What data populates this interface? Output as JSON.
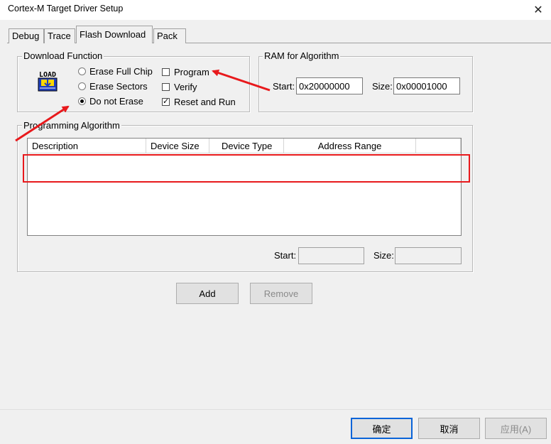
{
  "window": {
    "title": "Cortex-M Target Driver Setup",
    "close_glyph": "✕"
  },
  "tabs": [
    {
      "label": "Debug"
    },
    {
      "label": "Trace"
    },
    {
      "label": "Flash Download"
    },
    {
      "label": "Pack"
    }
  ],
  "download_function": {
    "title": "Download Function",
    "icon_text": "LOAD",
    "radios": [
      {
        "label": "Erase Full Chip",
        "selected": false
      },
      {
        "label": "Erase Sectors",
        "selected": false
      },
      {
        "label": "Do not Erase",
        "selected": true
      }
    ],
    "checkboxes": [
      {
        "label": "Program",
        "checked": false
      },
      {
        "label": "Verify",
        "checked": false
      },
      {
        "label": "Reset and Run",
        "checked": true,
        "mark": "✓"
      }
    ]
  },
  "ram": {
    "title": "RAM for Algorithm",
    "start_label": "Start:",
    "start_value": "0x20000000",
    "size_label": "Size:",
    "size_value": "0x00001000"
  },
  "programming": {
    "title": "Programming Algorithm",
    "columns": [
      "Description",
      "Device Size",
      "Device Type",
      "Address Range"
    ],
    "start_label": "Start:",
    "start_value": "",
    "size_label": "Size:",
    "size_value": ""
  },
  "buttons": {
    "add": "Add",
    "remove": "Remove"
  },
  "footer": {
    "ok": "确定",
    "cancel": "取消",
    "apply": "应用(A)"
  },
  "colors": {
    "annotation": "#e8191c",
    "default_button_border": "#0a64d8",
    "icon_blue": "#1f3fbf",
    "icon_yellow": "#ffd800"
  }
}
